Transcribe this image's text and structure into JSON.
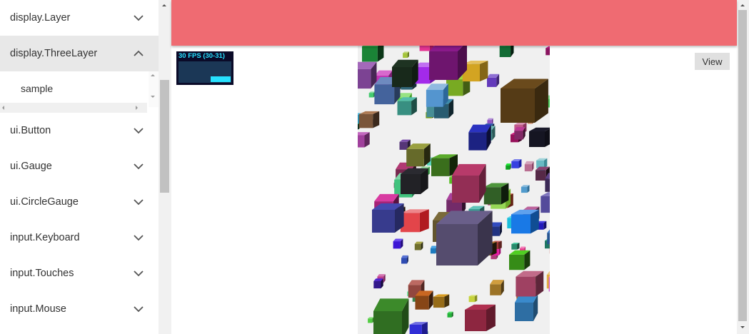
{
  "sidebar": {
    "items": [
      {
        "label": "display.Layer",
        "open": false
      },
      {
        "label": "display.ThreeLayer",
        "open": true
      },
      {
        "label": "ui.Button",
        "open": false
      },
      {
        "label": "ui.Gauge",
        "open": false
      },
      {
        "label": "ui.CircleGauge",
        "open": false
      },
      {
        "label": "input.Keyboard",
        "open": false
      },
      {
        "label": "input.Touches",
        "open": false
      },
      {
        "label": "input.Mouse",
        "open": false
      }
    ],
    "sub_items": [
      "sample"
    ]
  },
  "header": {
    "color": "#ef6b72"
  },
  "stats": {
    "fps_text": "30 FPS (30-31)",
    "fps": 30
  },
  "view_button": {
    "label": "View"
  },
  "scene": {
    "description_icon": "three-cubes-scene"
  }
}
